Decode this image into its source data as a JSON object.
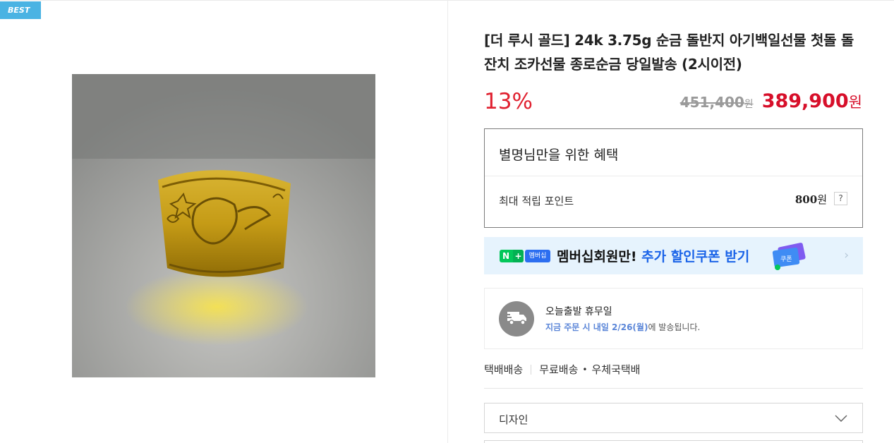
{
  "badge": "BEST",
  "product": {
    "title": "[더 루시 골드] 24k 3.75g 순금 돌반지 아기백일선물 첫돌 돌잔치 조카선물 종로순금 당일발송 (2시이전)",
    "image_icon": "gold-ring-photo"
  },
  "price": {
    "discount": "13%",
    "original": "451,400",
    "original_unit": "원",
    "sale": "389,900",
    "sale_unit": "원"
  },
  "benefit": {
    "title": "별명님만을 위한 혜택",
    "row_label": "최대 적립 포인트",
    "row_value": "800",
    "row_unit": "원",
    "help": "?"
  },
  "member_banner": {
    "n_badge": "N",
    "plus": "+",
    "tag": "멤버십",
    "text_prefix": "멤버십회원만!",
    "text_accent": "추가 할인쿠폰 받기",
    "coupon_label": "쿠폰",
    "chevron": "›"
  },
  "shipping": {
    "title": "오늘출발 휴무일",
    "sub_highlight": "지금 주문 시 내일 2/26(월)",
    "sub_rest": "에 발송됩니다."
  },
  "delivery": {
    "method": "택배배송",
    "fee": "무료배송",
    "dot": "•",
    "carrier": "우체국택배"
  },
  "option": {
    "label": "디자인"
  },
  "colors": {
    "discount": "#e0202f",
    "sale": "#d70f2a",
    "badge": "#4ab3e3",
    "banner_bg": "#e6f3fd",
    "accent": "#1a63e8"
  }
}
